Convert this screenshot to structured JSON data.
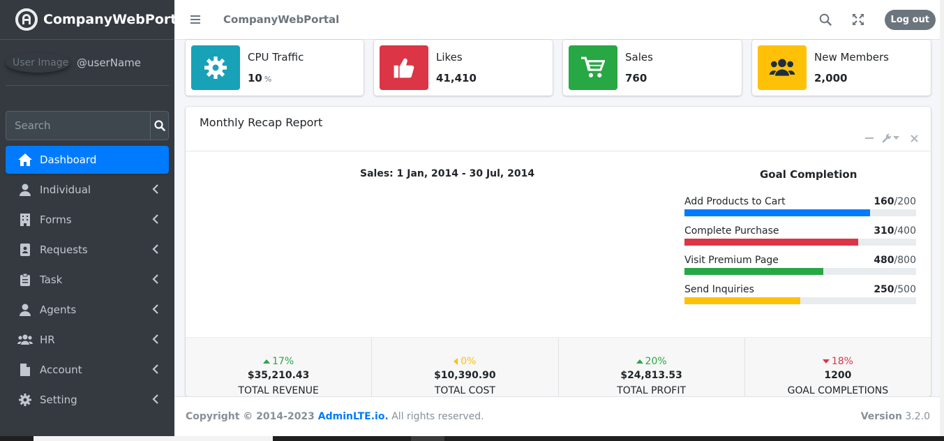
{
  "brand": {
    "name": "CompanyWebPortal"
  },
  "user": {
    "image_alt": "User Image",
    "name": "@userName"
  },
  "search": {
    "placeholder": "Search"
  },
  "nav": [
    {
      "label": "Dashboard",
      "icon": "home-icon",
      "active": true
    },
    {
      "label": "Individual",
      "icon": "user-icon"
    },
    {
      "label": "Forms",
      "icon": "building-icon"
    },
    {
      "label": "Requests",
      "icon": "id-card-icon"
    },
    {
      "label": "Task",
      "icon": "clipboard-icon"
    },
    {
      "label": "Agents",
      "icon": "user-icon"
    },
    {
      "label": "HR",
      "icon": "users-icon"
    },
    {
      "label": "Account",
      "icon": "file-icon"
    },
    {
      "label": "Setting",
      "icon": "gear-icon"
    }
  ],
  "header": {
    "title": "CompanyWebPortal",
    "logout_label": "Log out"
  },
  "info_boxes": [
    {
      "label": "CPU Traffic",
      "value": "10",
      "unit": "%",
      "color": "#17a2b8",
      "icon": "gear-icon"
    },
    {
      "label": "Likes",
      "value": "41,410",
      "color": "#dc3545",
      "icon": "thumbs-up-icon"
    },
    {
      "label": "Sales",
      "value": "760",
      "color": "#28a745",
      "icon": "shopping-cart-icon"
    },
    {
      "label": "New Members",
      "value": "2,000",
      "color": "#ffc107",
      "icon": "users-icon"
    }
  ],
  "report": {
    "title": "Monthly Recap Report",
    "chart_title": "Sales: 1 Jan, 2014 - 30 Jul, 2014",
    "goal_title": "Goal Completion",
    "goals": [
      {
        "label": "Add Products to Cart",
        "value": "160",
        "total": "/200",
        "fraction": 0.8,
        "color": "#007bff"
      },
      {
        "label": "Complete Purchase",
        "value": "310",
        "total": "/400",
        "fraction": 0.75,
        "color": "#dc3545"
      },
      {
        "label": "Visit Premium Page",
        "value": "480",
        "total": "/800",
        "fraction": 0.6,
        "color": "#28a745"
      },
      {
        "label": "Send Inquiries",
        "value": "250",
        "total": "/500",
        "fraction": 0.5,
        "color": "#ffc107"
      }
    ],
    "stats": [
      {
        "pct": "17%",
        "direction": "up",
        "color": "#28a745",
        "amount": "$35,210.43",
        "label": "TOTAL REVENUE"
      },
      {
        "pct": "0%",
        "direction": "left",
        "color": "#ffc107",
        "amount": "$10,390.90",
        "label": "TOTAL COST"
      },
      {
        "pct": "20%",
        "direction": "up",
        "color": "#28a745",
        "amount": "$24,813.53",
        "label": "TOTAL PROFIT"
      },
      {
        "pct": "18%",
        "direction": "down",
        "color": "#dc3545",
        "amount": "1200",
        "label": "GOAL COMPLETIONS"
      }
    ]
  },
  "footer": {
    "copyright": "Copyright © 2014-2023 ",
    "link": "AdminLTE.io.",
    "rights": " All rights reserved.",
    "version_label": "Version",
    "version": " 3.2.0"
  }
}
